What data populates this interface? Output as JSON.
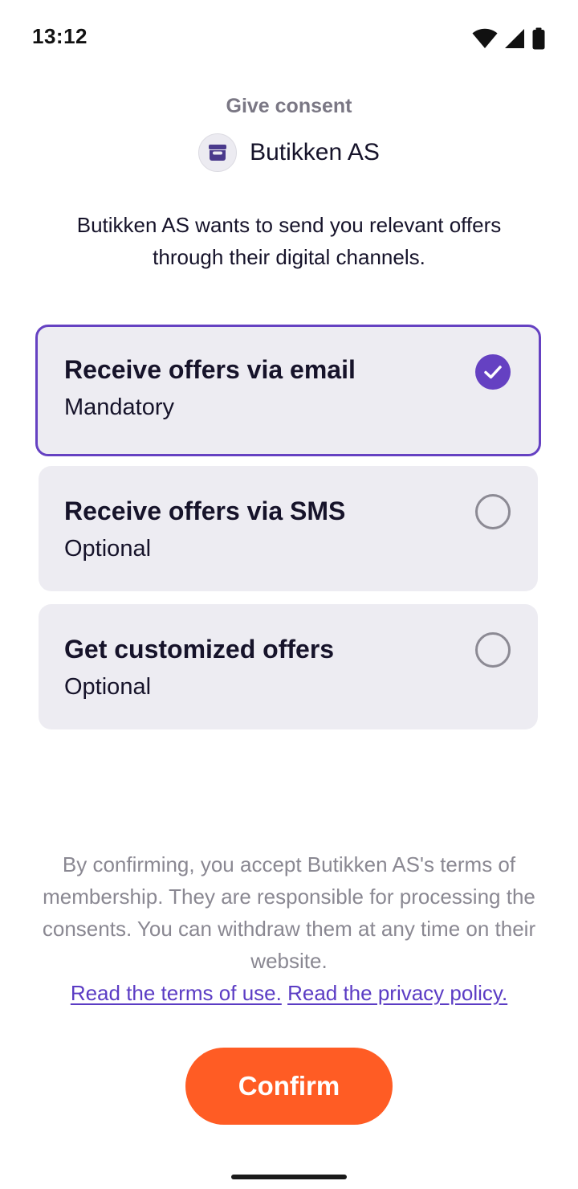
{
  "status_bar": {
    "time": "13:12",
    "icons": [
      "wifi-icon",
      "cellular-signal-icon",
      "battery-icon"
    ]
  },
  "header": {
    "title": "Give consent",
    "merchant_name": "Butikken AS",
    "merchant_logo_icon": "storefront-icon"
  },
  "intro": {
    "text": "Butikken AS wants to send you relevant offers through their digital channels."
  },
  "options": [
    {
      "title": "Receive offers via email",
      "subtitle": "Mandatory",
      "checked": true
    },
    {
      "title": "Receive offers via SMS",
      "subtitle": "Optional",
      "checked": false
    },
    {
      "title": "Get customized offers",
      "subtitle": "Optional",
      "checked": false
    }
  ],
  "disclaimer": {
    "text": "By confirming, you accept Butikken AS's terms of membership. They are responsible for processing the consents. You can withdraw them at any time on their website.",
    "terms_link": "Read the terms of use.",
    "privacy_link": "Read the privacy policy."
  },
  "confirm_button": {
    "label": "Confirm"
  },
  "colors": {
    "accent": "#6541c2",
    "primary_button": "#ff5c24",
    "option_background": "#edecf2",
    "link": "#5b3cc4",
    "muted_text": "#8a8892"
  }
}
